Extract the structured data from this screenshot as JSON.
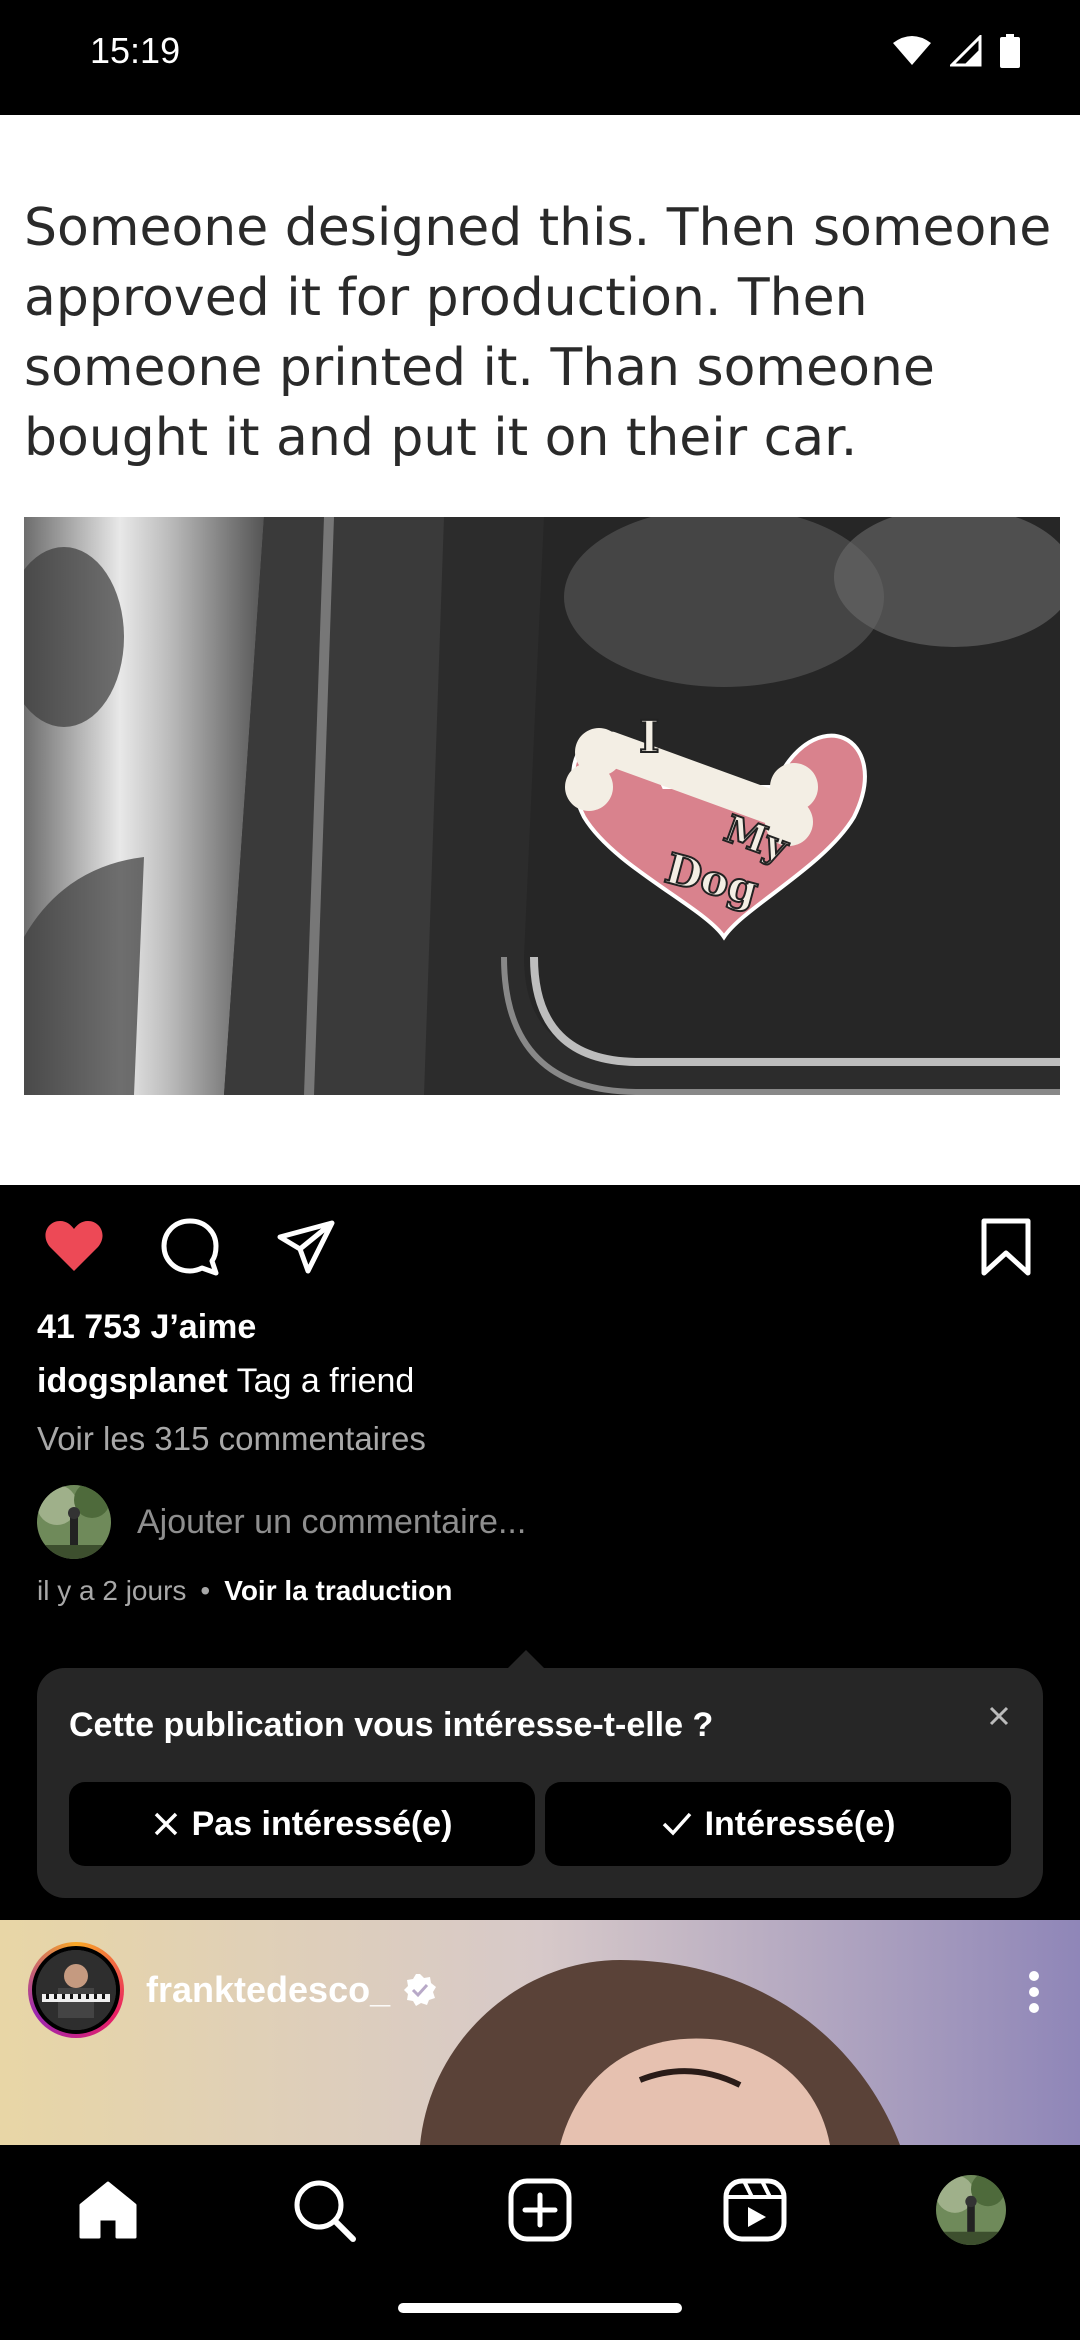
{
  "status_bar": {
    "time": "15:19"
  },
  "post": {
    "meme_caption": "Someone designed this. Then someone approved it for production. Then someone printed it. Than someone bought it and put it on their car.",
    "sticker_text": [
      "I",
      "My",
      "Dog"
    ],
    "likes": "41 753 J’aime",
    "username": "idogsplanet",
    "caption": "Tag a friend",
    "view_comments": "Voir les 315 commentaires",
    "add_comment_placeholder": "Ajouter un commentaire...",
    "time_ago": "il y a 2 jours",
    "dot": "•",
    "translate": "Voir la traduction",
    "liked": true,
    "like_color": "#ed4956"
  },
  "interest_prompt": {
    "question": "Cette publication vous intéresse-t-elle ?",
    "not_interested": "Pas intéressé(e)",
    "interested": "Intéressé(e)"
  },
  "next_post": {
    "username": "franktedesco_",
    "verified": true
  },
  "bottom_nav": [
    "home-icon",
    "search-icon",
    "create-icon",
    "reels-icon",
    "profile-avatar"
  ]
}
